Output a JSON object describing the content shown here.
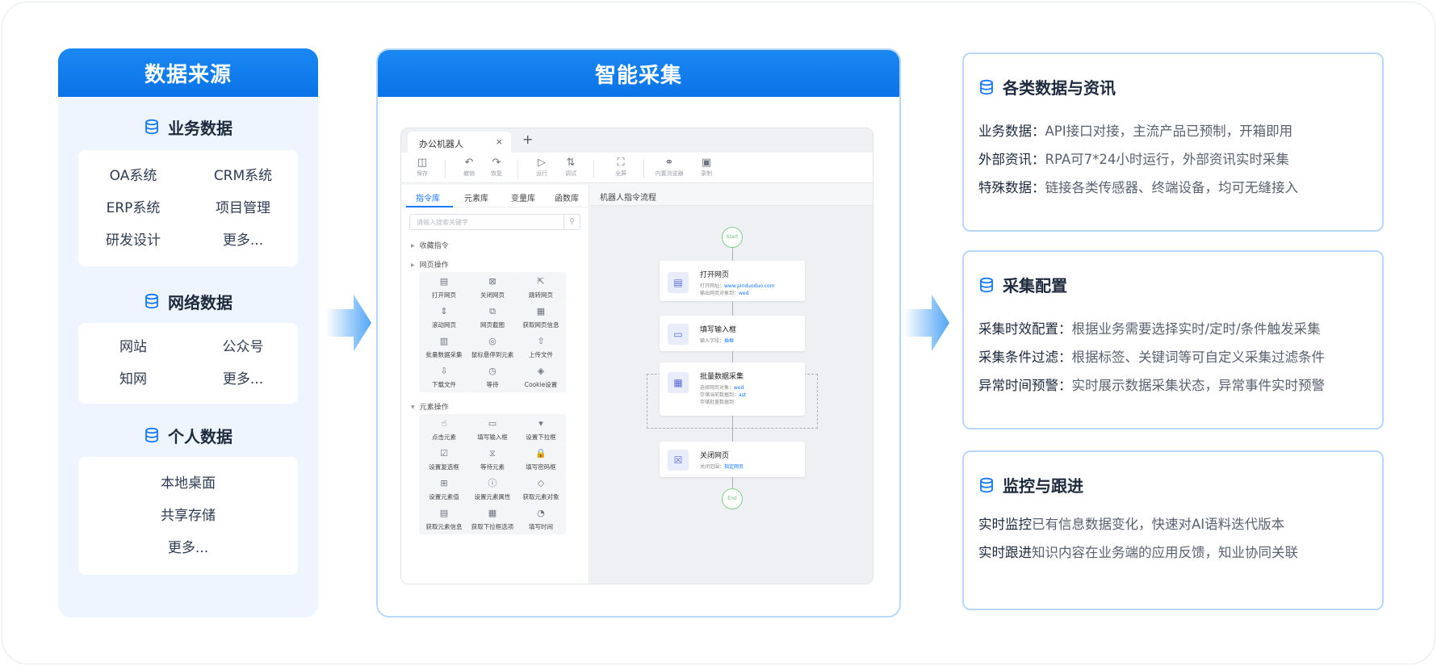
{
  "left": {
    "title": "数据来源",
    "groups": [
      {
        "title": "业务数据",
        "items": [
          "OA系统",
          "CRM系统",
          "ERP系统",
          "项目管理",
          "研发设计",
          "更多..."
        ]
      },
      {
        "title": "网络数据",
        "items": [
          "网站",
          "公众号",
          "知网",
          "更多..."
        ]
      },
      {
        "title": "个人数据",
        "items": [
          "本地桌面",
          "共享存储",
          "更多..."
        ]
      }
    ]
  },
  "middle": {
    "title": "智能采集",
    "app": {
      "tab_label": "办公机器人",
      "tab_close": "×",
      "tab_add": "+",
      "toolbar": [
        {
          "label": "保存",
          "icon": "save-icon"
        },
        {
          "label": "撤销",
          "icon": "undo-icon"
        },
        {
          "label": "恢复",
          "icon": "redo-icon"
        },
        {
          "label": "运行",
          "icon": "run-icon"
        },
        {
          "label": "调试",
          "icon": "debug-icon"
        },
        {
          "label": "全屏",
          "icon": "fullscreen-icon"
        },
        {
          "label": "内置浏览器",
          "icon": "browser-icon"
        },
        {
          "label": "录制",
          "icon": "record-icon"
        }
      ],
      "panel_tabs": [
        "指令库",
        "元素库",
        "变量库",
        "函数库"
      ],
      "search_placeholder": "请输入搜索关键字",
      "sections": [
        "收藏指令",
        "网页操作",
        "元素操作"
      ],
      "web_commands": [
        "打开网页",
        "关闭网页",
        "跳转网页",
        "滚动网页",
        "网页截图",
        "获取网页信息",
        "批量数据采集",
        "鼠标悬停到元素",
        "上传文件",
        "下载文件",
        "等待",
        "Cookie设置"
      ],
      "element_commands": [
        "点击元素",
        "填写输入框",
        "设置下拉框",
        "设置复选框",
        "等待元素",
        "填写密码框",
        "设置元素值",
        "设置元素属性",
        "获取元素对象",
        "获取元素信息",
        "获取下拉框选项",
        "填写时间"
      ],
      "canvas_title": "机器人指令流程",
      "start_label": "Start",
      "end_label": "End",
      "steps": [
        {
          "title": "打开网页",
          "lines": [
            {
              "k": "打开网址：",
              "v": "www.pinduoduo.com"
            },
            {
              "k": "输出网页对象到：",
              "v": "wed"
            }
          ]
        },
        {
          "title": "填写输入框",
          "lines": [
            {
              "k": "输入字段：",
              "v": "插框"
            }
          ]
        },
        {
          "title": "批量数据采集",
          "lines": [
            {
              "k": "选择网页对象：",
              "v": "wed"
            },
            {
              "k": "存储当前数据到：",
              "v": "ast"
            },
            {
              "k": "存储批量数据到",
              "v": ""
            }
          ]
        },
        {
          "title": "关闭网页",
          "lines": [
            {
              "k": "关闭范围：",
              "v": "指定网页"
            }
          ]
        }
      ]
    }
  },
  "right": {
    "cards": [
      {
        "title": "各类数据与资讯",
        "lines": [
          {
            "k": "业务数据：",
            "v": "API接口对接，主流产品已预制，开箱即用"
          },
          {
            "k": "外部资讯：",
            "v": "RPA可7*24小时运行，外部资讯实时采集"
          },
          {
            "k": "特殊数据：",
            "v": "链接各类传感器、终端设备，均可无缝接入"
          }
        ]
      },
      {
        "title": "采集配置",
        "lines": [
          {
            "k": "采集时效配置：",
            "v": "根据业务需要选择实时/定时/条件触发采集"
          },
          {
            "k": "采集条件过滤：",
            "v": "根据标签、关键词等可自定义采集过滤条件"
          },
          {
            "k": "异常时间预警：",
            "v": "实时展示数据采集状态，异常事件实时预警"
          }
        ]
      },
      {
        "title": "监控与跟进",
        "lines": [
          {
            "k": "实时监控",
            "v": "已有信息数据变化，快速对AI语料迭代版本"
          },
          {
            "k": "实时跟进",
            "v": "知识内容在业务端的应用反馈，知业协同关联"
          }
        ]
      }
    ]
  },
  "colors": {
    "accent": "#0a73e8",
    "border": "#b9d7fb",
    "panel_bg": "#eef5ff"
  }
}
